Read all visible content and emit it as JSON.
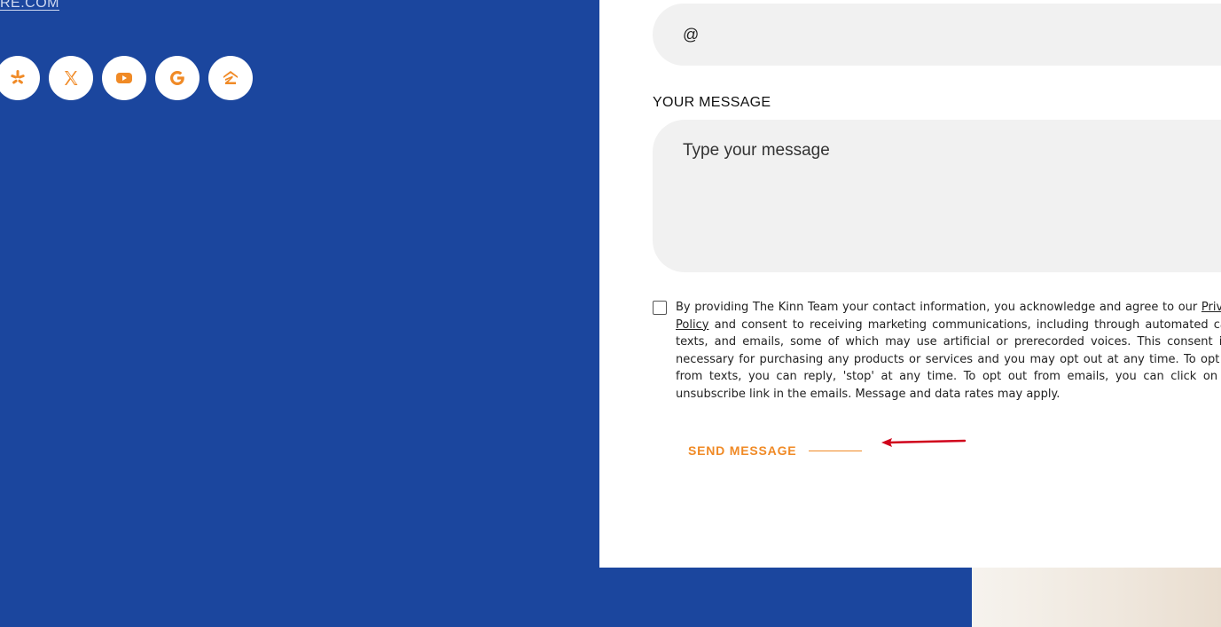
{
  "left_panel": {
    "top_link": "RE.COM",
    "social": [
      {
        "icon": "yelp-icon"
      },
      {
        "icon": "x-icon"
      },
      {
        "icon": "youtube-icon"
      },
      {
        "icon": "google-icon"
      },
      {
        "icon": "zillow-icon"
      }
    ]
  },
  "form": {
    "email_value": "@",
    "message_label": "YOUR MESSAGE",
    "message_placeholder": "Type your message",
    "consent": {
      "before_link": "By providing The Kinn Team your contact information, you acknowledge and agree to our ",
      "link_text": "Privacy Policy",
      "after_link": " and consent to receiving marketing communications, including through automated calls, texts, and emails, some of which may use artificial or prerecorded voices. This consent isn't necessary for purchasing any products or services and you may opt out at any time. To opt out from texts, you can reply, 'stop' at any time. To opt out from emails, you can click on the unsubscribe link in the emails. Message and data rates may apply."
    },
    "send_label": "SEND MESSAGE"
  },
  "colors": {
    "accent": "#f08a26",
    "background_blue": "#1b469e",
    "annotation_arrow": "#d0021b"
  }
}
